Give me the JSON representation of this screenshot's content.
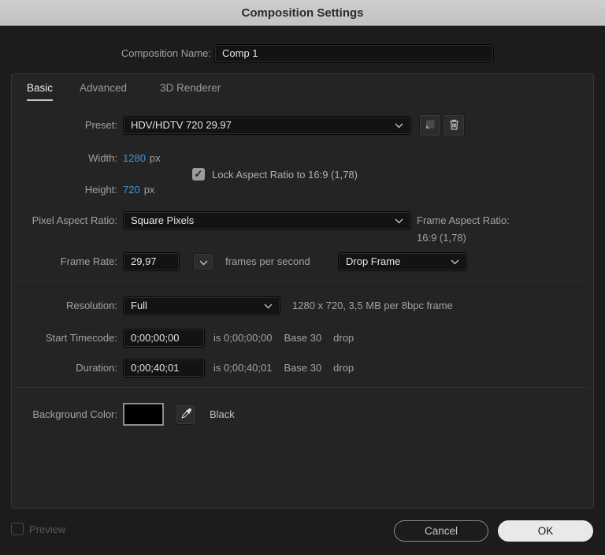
{
  "title": "Composition Settings",
  "colors": {
    "accent_blue": "#4093d6",
    "swatch": "#000000",
    "ok_bg": "#e9e9e9"
  },
  "icons": {
    "check": "✓"
  },
  "name_row": {
    "label": "Composition Name:",
    "value": "Comp 1"
  },
  "tabs": [
    {
      "label": "Basic",
      "active": true
    },
    {
      "label": "Advanced",
      "active": false
    },
    {
      "label": "3D Renderer",
      "active": false
    }
  ],
  "preset": {
    "label": "Preset:",
    "value": "HDV/HDTV 720 29.97"
  },
  "dimensions": {
    "width_label": "Width:",
    "width_value": "1280",
    "width_unit": "px",
    "height_label": "Height:",
    "height_value": "720",
    "height_unit": "px",
    "lock_label": "Lock Aspect Ratio to 16:9 (1,78)",
    "lock_checked": true
  },
  "pixel_aspect": {
    "label": "Pixel Aspect Ratio:",
    "value": "Square Pixels",
    "frame_aspect_label": "Frame Aspect Ratio:",
    "frame_aspect_value": "16:9 (1,78)"
  },
  "frame_rate": {
    "label": "Frame Rate:",
    "value": "29,97",
    "unit": "frames per second",
    "dropdown_value": "Drop Frame"
  },
  "resolution": {
    "label": "Resolution:",
    "value": "Full",
    "info": "1280 x 720, 3,5 MB per 8bpc frame"
  },
  "start_timecode": {
    "label": "Start Timecode:",
    "value": "0;00;00;00",
    "is_text": "is 0;00;00;00",
    "base_text": "Base 30",
    "drop_text": "drop"
  },
  "duration": {
    "label": "Duration:",
    "value": "0;00;40;01",
    "is_text": "is 0;00;40;01",
    "base_text": "Base 30",
    "drop_text": "drop"
  },
  "background_color": {
    "label": "Background Color:",
    "swatch_color": "#000000",
    "color_name": "Black"
  },
  "footer": {
    "preview_label": "Preview",
    "preview_checked": false,
    "cancel_label": "Cancel",
    "ok_label": "OK"
  }
}
